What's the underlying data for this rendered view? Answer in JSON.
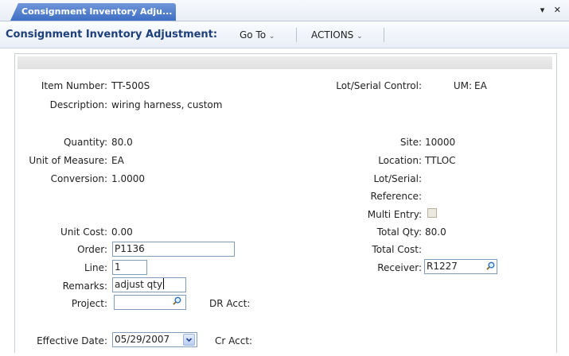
{
  "tab": {
    "title": "Consignment Inventory Adju...",
    "controls": "▾ ✕"
  },
  "toolbar": {
    "title": "Consignment Inventory Adjustment:",
    "goto": "Go To",
    "actions": "ACTIONS",
    "caret": "⌄"
  },
  "form": {
    "item_number": {
      "label": "Item Number:",
      "value": "TT-500S"
    },
    "description": {
      "label": "Description:",
      "value": "wiring harness, custom"
    },
    "lot_serial_control": {
      "label": "Lot/Serial Control:"
    },
    "um": {
      "label": "UM:",
      "value": "EA"
    },
    "quantity": {
      "label": "Quantity:",
      "value": "80.0"
    },
    "unit_of_measure": {
      "label": "Unit of Measure:",
      "value": "EA"
    },
    "conversion": {
      "label": "Conversion:",
      "value": "1.0000"
    },
    "site": {
      "label": "Site:",
      "value": "10000"
    },
    "location": {
      "label": "Location:",
      "value": "TTLOC"
    },
    "lot_serial": {
      "label": "Lot/Serial:"
    },
    "reference": {
      "label": "Reference:"
    },
    "multi_entry": {
      "label": "Multi Entry:",
      "checked": false
    },
    "unit_cost": {
      "label": "Unit Cost:",
      "value": "0.00"
    },
    "total_qty": {
      "label": "Total Qty:",
      "value": "80.0"
    },
    "order": {
      "label": "Order:",
      "value": "P1136"
    },
    "total_cost": {
      "label": "Total Cost:"
    },
    "line": {
      "label": "Line:",
      "value": "1"
    },
    "receiver": {
      "label": "Receiver:",
      "value": "R1227"
    },
    "remarks": {
      "label": "Remarks:",
      "value": "adjust qty"
    },
    "project": {
      "label": "Project:",
      "value": ""
    },
    "dr_acct": {
      "label": "DR Acct:"
    },
    "effective_date": {
      "label": "Effective Date:",
      "value": "05/29/2007"
    },
    "cr_acct": {
      "label": "Cr Acct:"
    }
  },
  "icons": {
    "lookup": "magnifier-icon",
    "dropdown": "chevron-down-icon"
  }
}
